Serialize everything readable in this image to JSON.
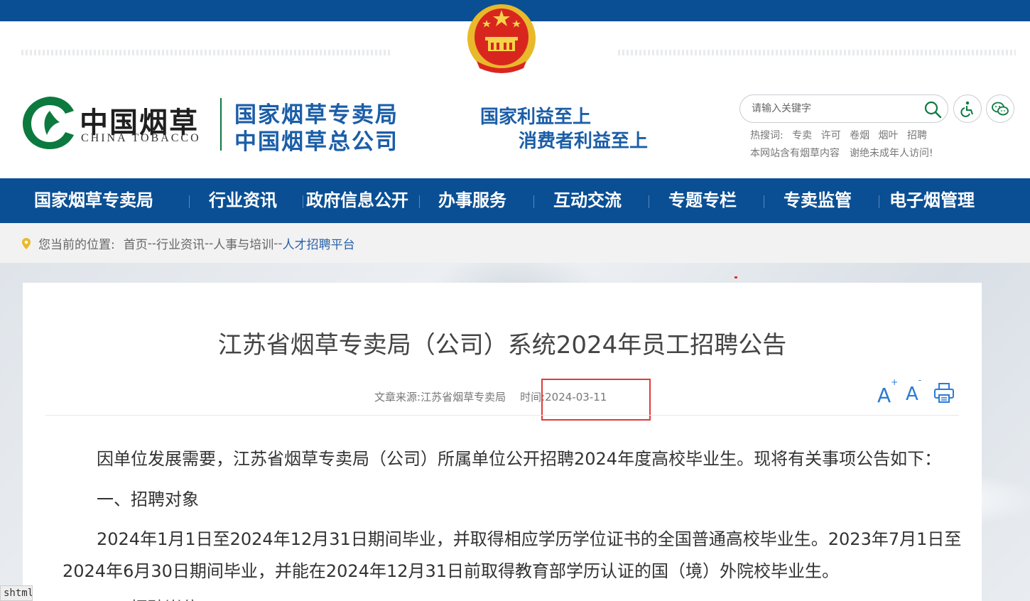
{
  "logo": {
    "cn": "中国烟草",
    "en": "CHINA TOBACCO",
    "org_line1": "国家烟草专卖局",
    "org_line2": "中国烟草总公司"
  },
  "slogan": {
    "line1": "国家利益至上",
    "line2": "消费者利益至上"
  },
  "search": {
    "placeholder": "请输入关键字"
  },
  "hotwords": {
    "label": "热搜词:",
    "items": [
      "专卖",
      "许可",
      "卷烟",
      "烟叶",
      "招聘"
    ]
  },
  "notice": {
    "part1": "本网站含有烟草内容",
    "part2": "谢绝未成年人访问!"
  },
  "nav": {
    "items": [
      {
        "label": "国家烟草专卖局"
      },
      {
        "label": "行业资讯"
      },
      {
        "label": "政府信息公开"
      },
      {
        "label": "办事服务"
      },
      {
        "label": "互动交流"
      },
      {
        "label": "专题专栏"
      },
      {
        "label": "专卖监管"
      },
      {
        "label": "电子烟管理"
      }
    ]
  },
  "breadcrumb": {
    "label": "您当前的位置:",
    "items": [
      "首页",
      "行业资讯",
      "人事与培训"
    ],
    "separator": "--",
    "current": "人才招聘平台"
  },
  "article": {
    "title": "江苏省烟草专卖局（公司）系统2024年员工招聘公告",
    "source_label": "文章来源:",
    "source": "江苏省烟草专卖局",
    "time_label": "时间:",
    "date": "2024-03-11",
    "font_increase": "A",
    "font_decrease": "A",
    "paragraphs": [
      "因单位发展需要，江苏省烟草专卖局（公司）所属单位公开招聘2024年度高校毕业生。现将有关事项公告如下：",
      "一、招聘对象",
      "2024年1月1日至2024年12月31日期间毕业，并取得相应学历学位证书的全国普通高校毕业生。2023年7月1日至",
      "2024年6月30日期间毕业，并能在2024年12月31日前取得教育部学历认证的国（境）外院校毕业生。",
      "二、招聘岗位"
    ]
  },
  "status_tag": "shtml",
  "colors": {
    "brand_blue": "#0a4f94",
    "logo_green": "#0c7a3f",
    "title_blue": "#1b5ea8",
    "highlight_red": "#e23a3a"
  }
}
